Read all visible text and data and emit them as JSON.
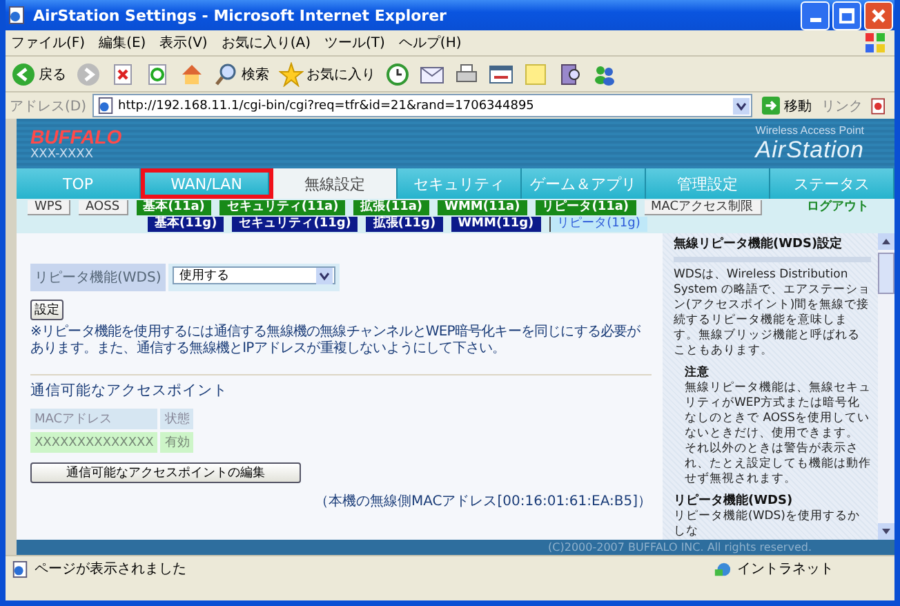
{
  "window": {
    "title": "AirStation Settings - Microsoft Internet Explorer"
  },
  "menu": [
    "ファイル(F)",
    "編集(E)",
    "表示(V)",
    "お気に入り(A)",
    "ツール(T)",
    "ヘルプ(H)"
  ],
  "toolbar": {
    "back": "戻る",
    "search": "検索",
    "favorites": "お気に入り"
  },
  "address": {
    "label": "アドレス(D)",
    "url": "http://192.168.11.1/cgi-bin/cgi?req=tfr&id=21&rand=1706344895",
    "go": "移動",
    "links": "リンク"
  },
  "header": {
    "brand": "BUFFALO",
    "model": "XXX-XXXX",
    "product_line": "Wireless Access Point",
    "product": "AirStation"
  },
  "tabs": [
    {
      "label": "TOP",
      "selected": false,
      "highlighted": false
    },
    {
      "label": "WAN/LAN",
      "selected": false,
      "highlighted": true
    },
    {
      "label": "無線設定",
      "selected": true,
      "highlighted": false
    },
    {
      "label": "セキュリティ",
      "selected": false,
      "highlighted": false
    },
    {
      "label": "ゲーム＆アプリ",
      "selected": false,
      "highlighted": false
    },
    {
      "label": "管理設定",
      "selected": false,
      "highlighted": false
    },
    {
      "label": "ステータス",
      "selected": false,
      "highlighted": false
    }
  ],
  "subnav_rows": [
    [
      {
        "label": "WPS",
        "kind": "plain",
        "selected": false
      },
      {
        "label": "AOSS",
        "kind": "plain",
        "selected": false
      },
      {
        "label": "基本(11a)",
        "kind": "band_a",
        "selected": false
      },
      {
        "label": "セキュリティ(11a)",
        "kind": "band_a",
        "selected": false
      },
      {
        "label": "拡張(11a)",
        "kind": "band_a",
        "selected": false
      },
      {
        "label": "WMM(11a)",
        "kind": "band_a",
        "selected": false
      },
      {
        "label": "リピータ(11a)",
        "kind": "band_a",
        "selected": false
      },
      {
        "label": "MACアクセス制限",
        "kind": "plain",
        "selected": false
      },
      {
        "label": "ログアウト",
        "kind": "link",
        "selected": false
      }
    ],
    [
      {
        "label": "基本(11g)",
        "kind": "band_g",
        "selected": false
      },
      {
        "label": "セキュリティ(11g)",
        "kind": "band_g",
        "selected": false
      },
      {
        "label": "拡張(11g)",
        "kind": "band_g",
        "selected": false
      },
      {
        "label": "WMM(11g)",
        "kind": "band_g",
        "selected": false
      },
      {
        "label": "リピータ(11g)",
        "kind": "band_g",
        "selected": true
      }
    ]
  ],
  "wds": {
    "label": "リピータ機能(WDS)",
    "value": "使用する"
  },
  "apply_button": "設定",
  "notice": "※リピータ機能を使用するには通信する無線機の無線チャンネルとWEP暗号化キーを同じにする必要があります。また、通信する無線機とIPアドレスが重複しないようにして下さい。",
  "access_points": {
    "title": "通信可能なアクセスポイント",
    "columns": [
      "MACアドレス",
      "状態"
    ],
    "rows": [
      [
        "XXXXXXXXXXXXXX",
        "有効"
      ]
    ],
    "edit_button": "通信可能なアクセスポイントの編集"
  },
  "mac_note": "（本機の無線側MACアドレス[00:16:01:61:EA:B5]）",
  "footer": "(C)2000-2007 BUFFALO INC. All rights reserved.",
  "help": {
    "title": "無線リピータ機能(WDS)設定",
    "text": "WDSは、Wireless Distribution System の略語で、エアステーション(アクセスポイント)間を無線で接続するリピータ機能を意味します。無線ブリッジ機能と呼ばれることもあります。",
    "note_title": "注意",
    "note_paragraphs": [
      "無線リピータ機能は、無線セキュリティがWEP方式または暗号化なしのときで AOSSを使用していないときだけ、使用できます。",
      "それ以外のときは警告が表示され、たとえ設定しても機能は動作せず無視されます。"
    ],
    "section_title": "リピータ機能(WDS)",
    "section_text": "リピータ機能(WDS)を使用するかしな"
  },
  "status_bar": {
    "text": "ページが表示されました",
    "zone": "イントラネット"
  }
}
